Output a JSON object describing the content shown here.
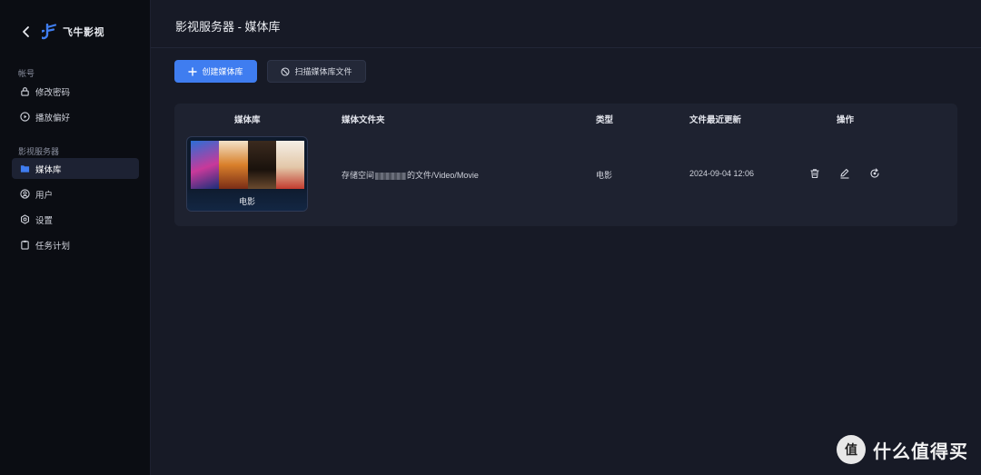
{
  "app": {
    "name": "飞牛影视"
  },
  "sidebar": {
    "sections": [
      {
        "label": "帐号"
      },
      {
        "label": "影视服务器"
      }
    ],
    "items": [
      {
        "label": "修改密码",
        "icon": "lock-icon"
      },
      {
        "label": "播放偏好",
        "icon": "play-circle-icon"
      },
      {
        "label": "媒体库",
        "icon": "folder-icon",
        "active": true
      },
      {
        "label": "用户",
        "icon": "user-icon"
      },
      {
        "label": "设置",
        "icon": "gear-icon"
      },
      {
        "label": "任务计划",
        "icon": "clipboard-icon"
      }
    ]
  },
  "header": {
    "title": "影视服务器 - 媒体库"
  },
  "toolbar": {
    "create_label": "创建媒体库",
    "scan_label": "扫描媒体库文件"
  },
  "table": {
    "columns": [
      "媒体库",
      "媒体文件夹",
      "类型",
      "文件最近更新",
      "操作"
    ],
    "rows": [
      {
        "library": "电影",
        "folder_prefix": "存储空间",
        "folder_suffix": "的文件/Video/Movie",
        "type": "电影",
        "updated": "2024-09-04 12:06"
      }
    ]
  },
  "watermark": {
    "text": "什么值得买",
    "badge": "值"
  },
  "colors": {
    "accent": "#3f7df0",
    "sidebar_bg": "#0b0d13",
    "main_bg": "#171a26",
    "card_bg": "#1e2230"
  }
}
